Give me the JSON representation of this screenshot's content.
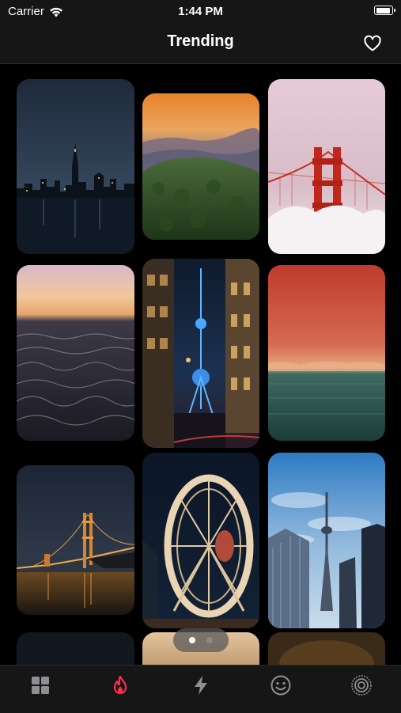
{
  "status_bar": {
    "carrier": "Carrier",
    "time": "1:44 PM",
    "battery_level": 0.95
  },
  "nav": {
    "title": "Trending",
    "favorite_icon": "heart-icon"
  },
  "wallpapers": [
    {
      "name": "city-skyline-night"
    },
    {
      "name": "misty-mountains-sunset"
    },
    {
      "name": "golden-gate-fog"
    },
    {
      "name": "ocean-waves-dusk"
    },
    {
      "name": "oriental-pearl-tower-night"
    },
    {
      "name": "red-sky-sea-moon"
    },
    {
      "name": "golden-gate-night-lights"
    },
    {
      "name": "ferris-wheel-night"
    },
    {
      "name": "cn-tower-blue-sky"
    }
  ],
  "pager": {
    "pages": 2,
    "current": 1
  },
  "tabs": [
    {
      "name": "tab-categories",
      "icon": "grid-icon",
      "active": false
    },
    {
      "name": "tab-trending",
      "icon": "flame-icon",
      "active": true
    },
    {
      "name": "tab-new",
      "icon": "lightning-icon",
      "active": false
    },
    {
      "name": "tab-fun",
      "icon": "smiley-icon",
      "active": false
    },
    {
      "name": "tab-live",
      "icon": "live-rings-icon",
      "active": false
    }
  ],
  "colors": {
    "background": "#000000",
    "bar": "#161616",
    "accent": "#ff2d55",
    "inactive_icon": "#8e8e93"
  }
}
